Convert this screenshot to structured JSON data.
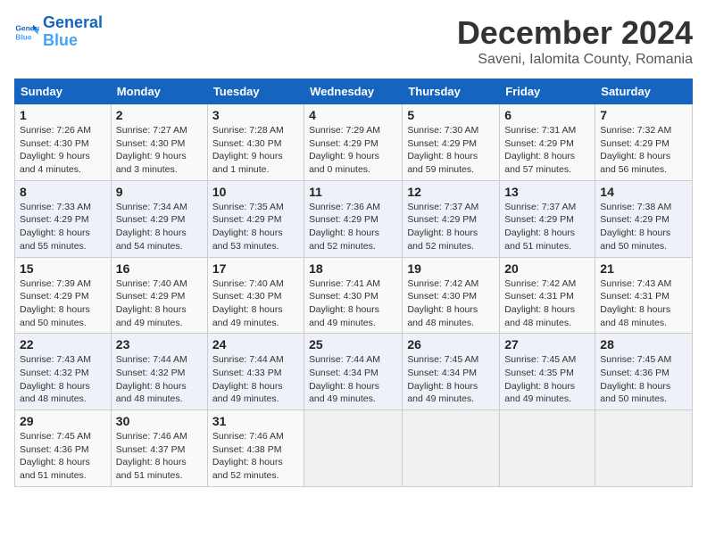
{
  "header": {
    "logo_line1": "General",
    "logo_line2": "Blue",
    "title": "December 2024",
    "subtitle": "Saveni, Ialomita County, Romania"
  },
  "days_of_week": [
    "Sunday",
    "Monday",
    "Tuesday",
    "Wednesday",
    "Thursday",
    "Friday",
    "Saturday"
  ],
  "weeks": [
    [
      {
        "day": "1",
        "info": "Sunrise: 7:26 AM\nSunset: 4:30 PM\nDaylight: 9 hours\nand 4 minutes."
      },
      {
        "day": "2",
        "info": "Sunrise: 7:27 AM\nSunset: 4:30 PM\nDaylight: 9 hours\nand 3 minutes."
      },
      {
        "day": "3",
        "info": "Sunrise: 7:28 AM\nSunset: 4:30 PM\nDaylight: 9 hours\nand 1 minute."
      },
      {
        "day": "4",
        "info": "Sunrise: 7:29 AM\nSunset: 4:29 PM\nDaylight: 9 hours\nand 0 minutes."
      },
      {
        "day": "5",
        "info": "Sunrise: 7:30 AM\nSunset: 4:29 PM\nDaylight: 8 hours\nand 59 minutes."
      },
      {
        "day": "6",
        "info": "Sunrise: 7:31 AM\nSunset: 4:29 PM\nDaylight: 8 hours\nand 57 minutes."
      },
      {
        "day": "7",
        "info": "Sunrise: 7:32 AM\nSunset: 4:29 PM\nDaylight: 8 hours\nand 56 minutes."
      }
    ],
    [
      {
        "day": "8",
        "info": "Sunrise: 7:33 AM\nSunset: 4:29 PM\nDaylight: 8 hours\nand 55 minutes."
      },
      {
        "day": "9",
        "info": "Sunrise: 7:34 AM\nSunset: 4:29 PM\nDaylight: 8 hours\nand 54 minutes."
      },
      {
        "day": "10",
        "info": "Sunrise: 7:35 AM\nSunset: 4:29 PM\nDaylight: 8 hours\nand 53 minutes."
      },
      {
        "day": "11",
        "info": "Sunrise: 7:36 AM\nSunset: 4:29 PM\nDaylight: 8 hours\nand 52 minutes."
      },
      {
        "day": "12",
        "info": "Sunrise: 7:37 AM\nSunset: 4:29 PM\nDaylight: 8 hours\nand 52 minutes."
      },
      {
        "day": "13",
        "info": "Sunrise: 7:37 AM\nSunset: 4:29 PM\nDaylight: 8 hours\nand 51 minutes."
      },
      {
        "day": "14",
        "info": "Sunrise: 7:38 AM\nSunset: 4:29 PM\nDaylight: 8 hours\nand 50 minutes."
      }
    ],
    [
      {
        "day": "15",
        "info": "Sunrise: 7:39 AM\nSunset: 4:29 PM\nDaylight: 8 hours\nand 50 minutes."
      },
      {
        "day": "16",
        "info": "Sunrise: 7:40 AM\nSunset: 4:29 PM\nDaylight: 8 hours\nand 49 minutes."
      },
      {
        "day": "17",
        "info": "Sunrise: 7:40 AM\nSunset: 4:30 PM\nDaylight: 8 hours\nand 49 minutes."
      },
      {
        "day": "18",
        "info": "Sunrise: 7:41 AM\nSunset: 4:30 PM\nDaylight: 8 hours\nand 49 minutes."
      },
      {
        "day": "19",
        "info": "Sunrise: 7:42 AM\nSunset: 4:30 PM\nDaylight: 8 hours\nand 48 minutes."
      },
      {
        "day": "20",
        "info": "Sunrise: 7:42 AM\nSunset: 4:31 PM\nDaylight: 8 hours\nand 48 minutes."
      },
      {
        "day": "21",
        "info": "Sunrise: 7:43 AM\nSunset: 4:31 PM\nDaylight: 8 hours\nand 48 minutes."
      }
    ],
    [
      {
        "day": "22",
        "info": "Sunrise: 7:43 AM\nSunset: 4:32 PM\nDaylight: 8 hours\nand 48 minutes."
      },
      {
        "day": "23",
        "info": "Sunrise: 7:44 AM\nSunset: 4:32 PM\nDaylight: 8 hours\nand 48 minutes."
      },
      {
        "day": "24",
        "info": "Sunrise: 7:44 AM\nSunset: 4:33 PM\nDaylight: 8 hours\nand 49 minutes."
      },
      {
        "day": "25",
        "info": "Sunrise: 7:44 AM\nSunset: 4:34 PM\nDaylight: 8 hours\nand 49 minutes."
      },
      {
        "day": "26",
        "info": "Sunrise: 7:45 AM\nSunset: 4:34 PM\nDaylight: 8 hours\nand 49 minutes."
      },
      {
        "day": "27",
        "info": "Sunrise: 7:45 AM\nSunset: 4:35 PM\nDaylight: 8 hours\nand 49 minutes."
      },
      {
        "day": "28",
        "info": "Sunrise: 7:45 AM\nSunset: 4:36 PM\nDaylight: 8 hours\nand 50 minutes."
      }
    ],
    [
      {
        "day": "29",
        "info": "Sunrise: 7:45 AM\nSunset: 4:36 PM\nDaylight: 8 hours\nand 51 minutes."
      },
      {
        "day": "30",
        "info": "Sunrise: 7:46 AM\nSunset: 4:37 PM\nDaylight: 8 hours\nand 51 minutes."
      },
      {
        "day": "31",
        "info": "Sunrise: 7:46 AM\nSunset: 4:38 PM\nDaylight: 8 hours\nand 52 minutes."
      },
      {
        "day": "",
        "info": ""
      },
      {
        "day": "",
        "info": ""
      },
      {
        "day": "",
        "info": ""
      },
      {
        "day": "",
        "info": ""
      }
    ]
  ]
}
